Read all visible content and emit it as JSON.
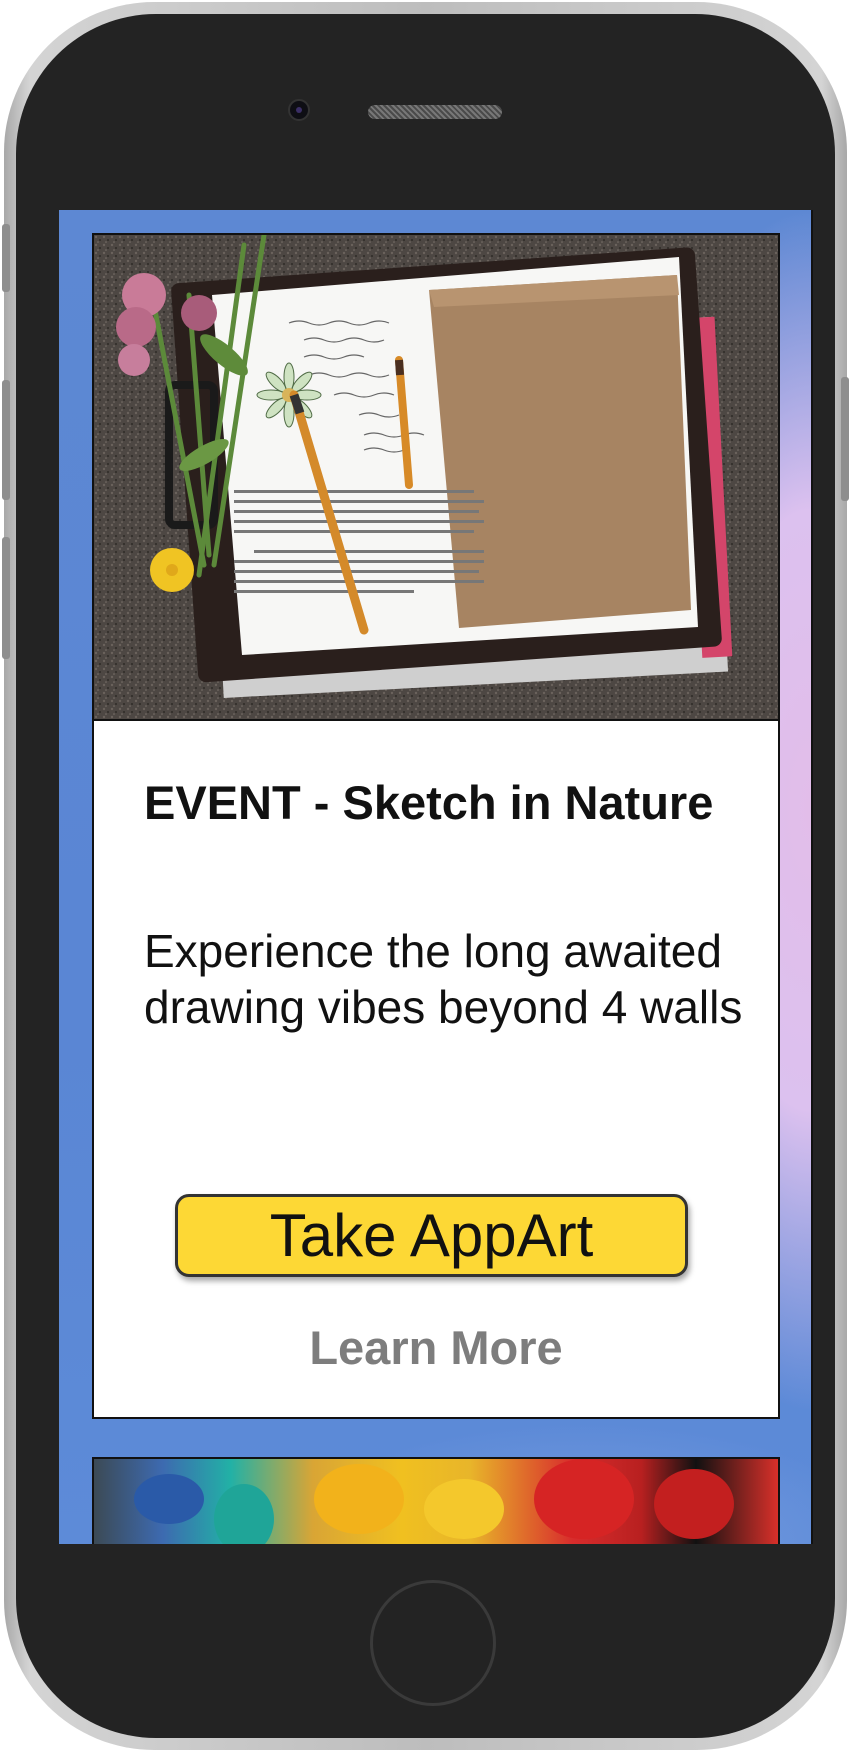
{
  "event_card": {
    "image_alt": "Open sketchbook with a flower drawing, pencils and wildflowers on asphalt",
    "title": "EVENT - Sketch in Nature",
    "description": "Experience the long awaited drawing vibes beyond 4 walls",
    "primary_button": "Take AppArt",
    "secondary_link": "Learn More"
  },
  "next_card": {
    "image_alt": "Colorful paint blobs"
  },
  "colors": {
    "screen_background": "#5b84d1",
    "button_fill": "#fdd835",
    "link_color": "#7d7d7d",
    "phone_body": "#232323"
  },
  "icons": {
    "home_button": "home-button-ring",
    "camera": "front-camera-dot",
    "speaker": "earpiece-grille"
  }
}
